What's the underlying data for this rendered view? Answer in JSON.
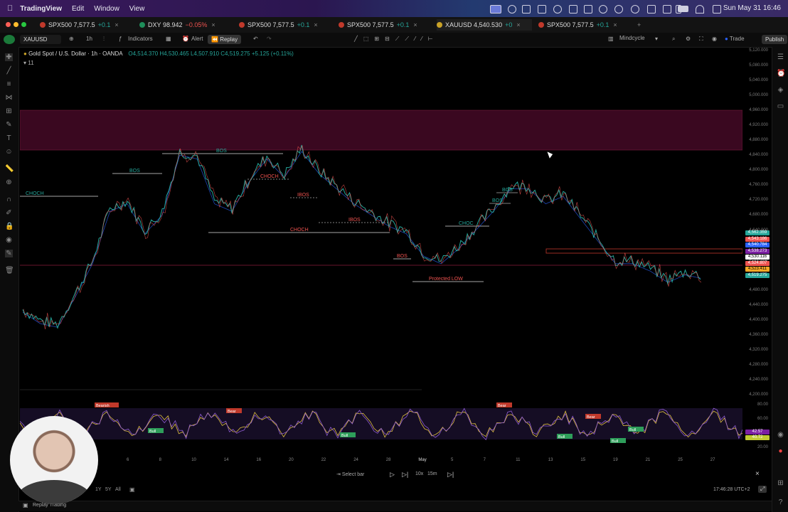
{
  "menubar": {
    "app": "TradingView",
    "items": [
      "Edit",
      "Window",
      "View"
    ],
    "clock": "Sun May 31  16:46"
  },
  "tabs": [
    {
      "name": "SPX500",
      "price": "7,577.5",
      "change": "+0.1"
    },
    {
      "name": "DXY",
      "price": "98.942",
      "change": "−0.05%"
    },
    {
      "name": "SPX500",
      "price": "7,577.5",
      "change": "+0.1"
    },
    {
      "name": "SPX500",
      "price": "7,577.5",
      "change": "+0.1"
    },
    {
      "name": "XAUUSD",
      "price": "4,540.530",
      "change": "+0"
    },
    {
      "name": "SPX500",
      "price": "7,577.5",
      "change": "+0.1"
    }
  ],
  "toolbar": {
    "symbol": "XAUUSD",
    "interval": "1h",
    "indicators": "Indicators",
    "alert": "Alert",
    "replay": "Replay",
    "layout": "Mindcycle",
    "trade": "Trade",
    "publish": "Publish"
  },
  "legend": {
    "title": "Gold Spot / U.S. Dollar · 1h · OANDA",
    "ohlc": "O4,514.370  H4,530.465  L4,507.910  C4,519.275  +5.125 (+0.11%)",
    "sub": "11"
  },
  "chart_data": {
    "type": "line",
    "title": "Gold Spot / U.S. Dollar · 1h · OANDA",
    "price_labels": [
      "5,120.000",
      "5,080.000",
      "5,040.000",
      "5,000.000",
      "4,960.000",
      "4,920.000",
      "4,880.000",
      "4,840.000",
      "4,800.000",
      "4,760.000",
      "4,720.000",
      "4,680.000",
      "4,640.000",
      "4,600.000",
      "4,560.000",
      "4,520.000",
      "4,480.000",
      "4,440.000",
      "4,400.000",
      "4,360.000",
      "4,320.000",
      "4,280.000",
      "4,240.000",
      "4,200.000"
    ],
    "ylim": [
      4200,
      5120
    ],
    "x_labels": [
      "6",
      "8",
      "10",
      "14",
      "16",
      "20",
      "22",
      "24",
      "28",
      "May",
      "5",
      "7",
      "11",
      "13",
      "15",
      "19",
      "21",
      "25",
      "27"
    ],
    "approx_close": [
      4430,
      4400,
      4390,
      4470,
      4560,
      4700,
      4720,
      4640,
      4690,
      4850,
      4840,
      4720,
      4700,
      4780,
      4840,
      4790,
      4860,
      4800,
      4760,
      4720,
      4690,
      4660,
      4640,
      4580,
      4560,
      4600,
      4650,
      4700,
      4760,
      4760,
      4720,
      4740,
      4680,
      4620,
      4560,
      4560,
      4540,
      4510,
      4530,
      4520
    ],
    "annotations": [
      "CHOCH",
      "BOS",
      "BOS",
      "CHOCH",
      "IBOS",
      "IBOS",
      "CHOCH",
      "BOS",
      "CHOC",
      "BOS",
      "BOS",
      "Protected LOW"
    ],
    "price_tags": [
      {
        "label": "4,562.359",
        "color": "#26a69a"
      },
      {
        "label": "4,543.186",
        "color": "#ef5350"
      },
      {
        "label": "4,540.784",
        "color": "#2962ff"
      },
      {
        "label": "4,538.273",
        "color": "#7b1fa2"
      },
      {
        "label": "4,530.116",
        "color": "#ffffff"
      },
      {
        "label": "4,524.807",
        "color": "#ef5350"
      },
      {
        "label": "4,523.411",
        "color": "#f9a825"
      },
      {
        "label": "4,519.275",
        "color": "#26a69a"
      }
    ],
    "osc_labels": [
      "80.00",
      "60.00",
      "40.00",
      "20.00"
    ],
    "osc_tags": [
      {
        "label": "42.57",
        "color": "#7b1fa2"
      },
      {
        "label": "40.72",
        "color": "#c0ca33"
      }
    ],
    "osc_markers": [
      "Bearish",
      "Bear",
      "Bull",
      "Bull",
      "Bear",
      "Bull",
      "Bear",
      "Bull",
      "Bull"
    ]
  },
  "replay": {
    "select_bar": "Select bar",
    "speed": "10x",
    "step": "15m",
    "ranges": [
      "1Y",
      "5Y",
      "All"
    ],
    "time": "17:46:28 UTC+2",
    "bottom": "Replay Trading"
  }
}
